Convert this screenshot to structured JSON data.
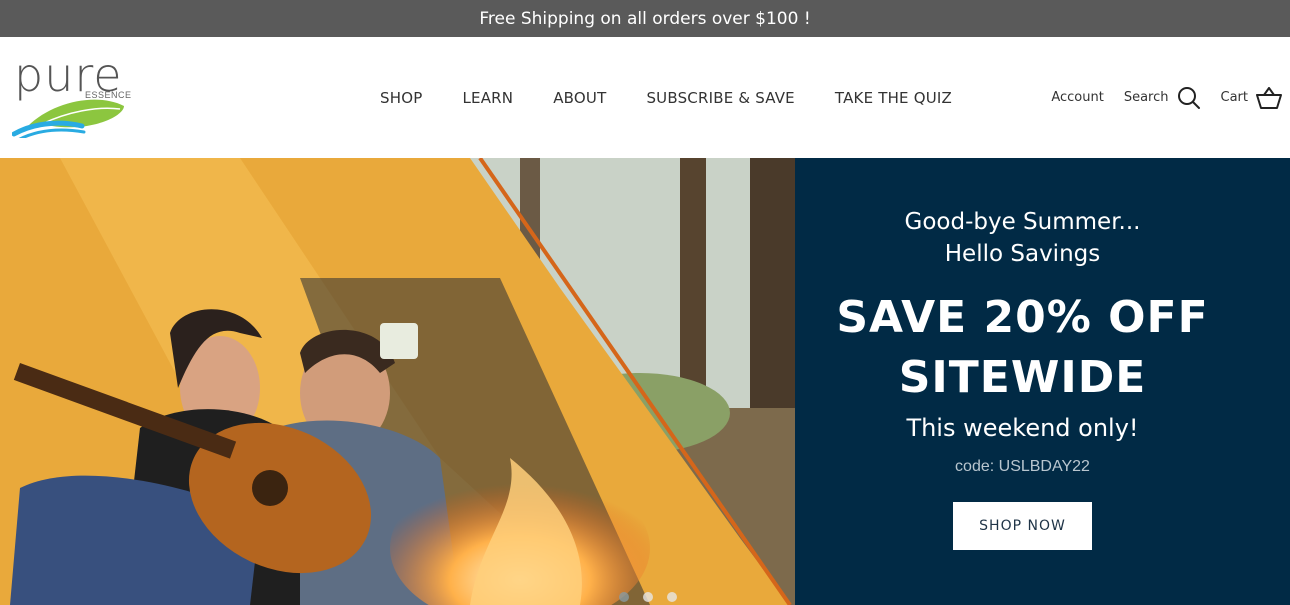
{
  "announcement": {
    "text": "Free Shipping on all orders over $100 !"
  },
  "logo": {
    "word": "pure",
    "sub": "ESSENCE"
  },
  "nav": {
    "items": [
      {
        "label": "SHOP"
      },
      {
        "label": "LEARN"
      },
      {
        "label": "ABOUT"
      },
      {
        "label": "SUBSCRIBE & SAVE"
      },
      {
        "label": "TAKE THE QUIZ"
      }
    ]
  },
  "utility": {
    "account_label": "Account",
    "search_label": "Search",
    "cart_label": "Cart",
    "search_icon": "search-icon",
    "cart_icon": "basket-icon"
  },
  "hero": {
    "line1": "Good-bye Summer...",
    "line2": "Hello Savings",
    "headline1": "SAVE 20% OFF",
    "headline2": "SITEWIDE",
    "subline": "This weekend only!",
    "code": "code: USLBDAY22",
    "cta": "SHOP NOW",
    "slides_total": 3,
    "active_slide": 1,
    "panel_color": "#012a45"
  },
  "colors": {
    "announcement_bg": "#5a5a5a",
    "logo_leaf": "#8cc63f",
    "logo_water": "#29abe2"
  }
}
